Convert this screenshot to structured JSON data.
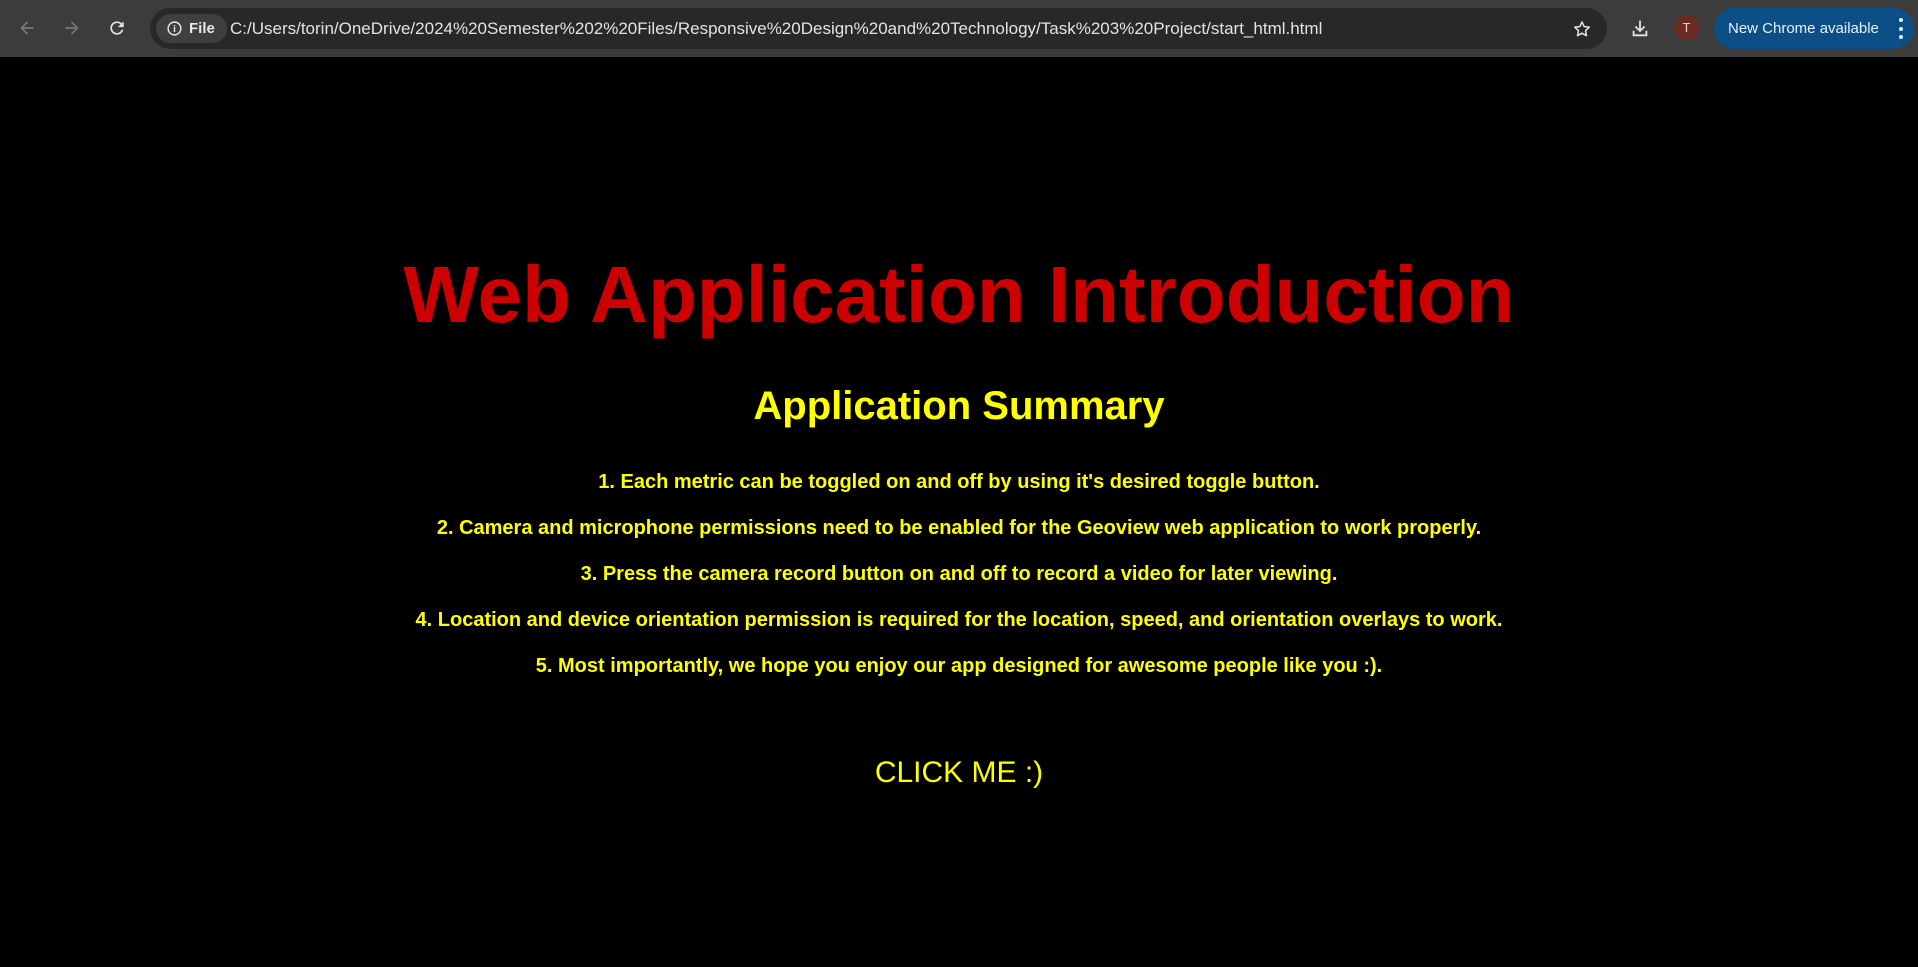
{
  "browser": {
    "site_chip_label": "File",
    "url": "C:/Users/torin/OneDrive/2024%20Semester%202%20Files/Responsive%20Design%20and%20Technology/Task%203%20Project/start_html.html",
    "avatar_initial": "T",
    "update_label": "New Chrome available",
    "icons": [
      "back-arrow-icon",
      "forward-arrow-icon",
      "reload-icon",
      "info-icon",
      "star-icon",
      "download-icon",
      "more-vert-icon"
    ]
  },
  "page": {
    "title": "Web Application Introduction",
    "subtitle": "Application Summary",
    "items": [
      "1. Each metric can be toggled on and off by using it's desired toggle button.",
      "2. Camera and microphone permissions need to be enabled for the Geoview web application to work properly.",
      "3. Press the camera record button on and off to record a video for later viewing.",
      "4. Location and device orientation permission is required for the location, speed, and orientation overlays to work.",
      "5. Most importantly, we hope you enjoy our app designed for awesome people like you :)."
    ],
    "button_label": "CLICK ME :)"
  },
  "colors": {
    "background": "#000000",
    "title": "#cc0000",
    "text": "#ffff00",
    "toolbar": "#3c3c3c",
    "update_button": "#0b4f86"
  }
}
